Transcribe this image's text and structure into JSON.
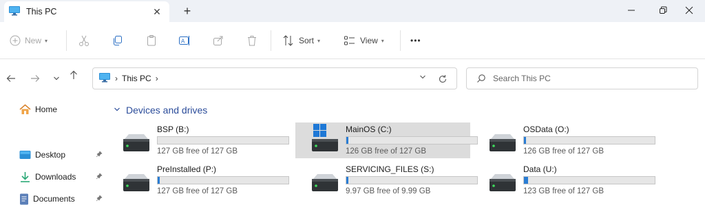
{
  "window": {
    "tab_title": "This PC",
    "tab_close": "✕",
    "new_tab": "+"
  },
  "toolbar": {
    "new_label": "New",
    "sort_label": "Sort",
    "view_label": "View",
    "more": "•••"
  },
  "address": {
    "crumb": "This PC",
    "separator": "›",
    "search_placeholder": "Search This PC"
  },
  "sidebar": {
    "home": "Home",
    "items": [
      {
        "label": "Desktop"
      },
      {
        "label": "Downloads"
      },
      {
        "label": "Documents"
      }
    ]
  },
  "main": {
    "group_title": "Devices and drives",
    "drives": [
      {
        "name": "BSP (B:)",
        "free": "127 GB free of 127 GB",
        "used_fraction": 0.0,
        "selected": false,
        "icon": "drive-icon"
      },
      {
        "name": "MainOS (C:)",
        "free": "126 GB free of 127 GB",
        "used_fraction": 0.01,
        "selected": true,
        "icon": "windows-drive-icon"
      },
      {
        "name": "OSData (O:)",
        "free": "126 GB free of 127 GB",
        "used_fraction": 0.01,
        "selected": false,
        "icon": "drive-icon"
      },
      {
        "name": "PreInstalled (P:)",
        "free": "127 GB free of 127 GB",
        "used_fraction": 0.01,
        "selected": false,
        "icon": "drive-icon"
      },
      {
        "name": "SERVICING_FILES (S:)",
        "free": "9.97 GB free of 9.99 GB",
        "used_fraction": 0.01,
        "selected": false,
        "icon": "drive-icon"
      },
      {
        "name": "Data (U:)",
        "free": "123 GB free of 127 GB",
        "used_fraction": 0.03,
        "selected": false,
        "icon": "drive-icon"
      }
    ]
  },
  "colors": {
    "accent": "#2a7dd4",
    "group_header": "#2b4c9a",
    "selected_bg": "#dcdcdc",
    "titlebar_bg": "#eef1f6"
  }
}
